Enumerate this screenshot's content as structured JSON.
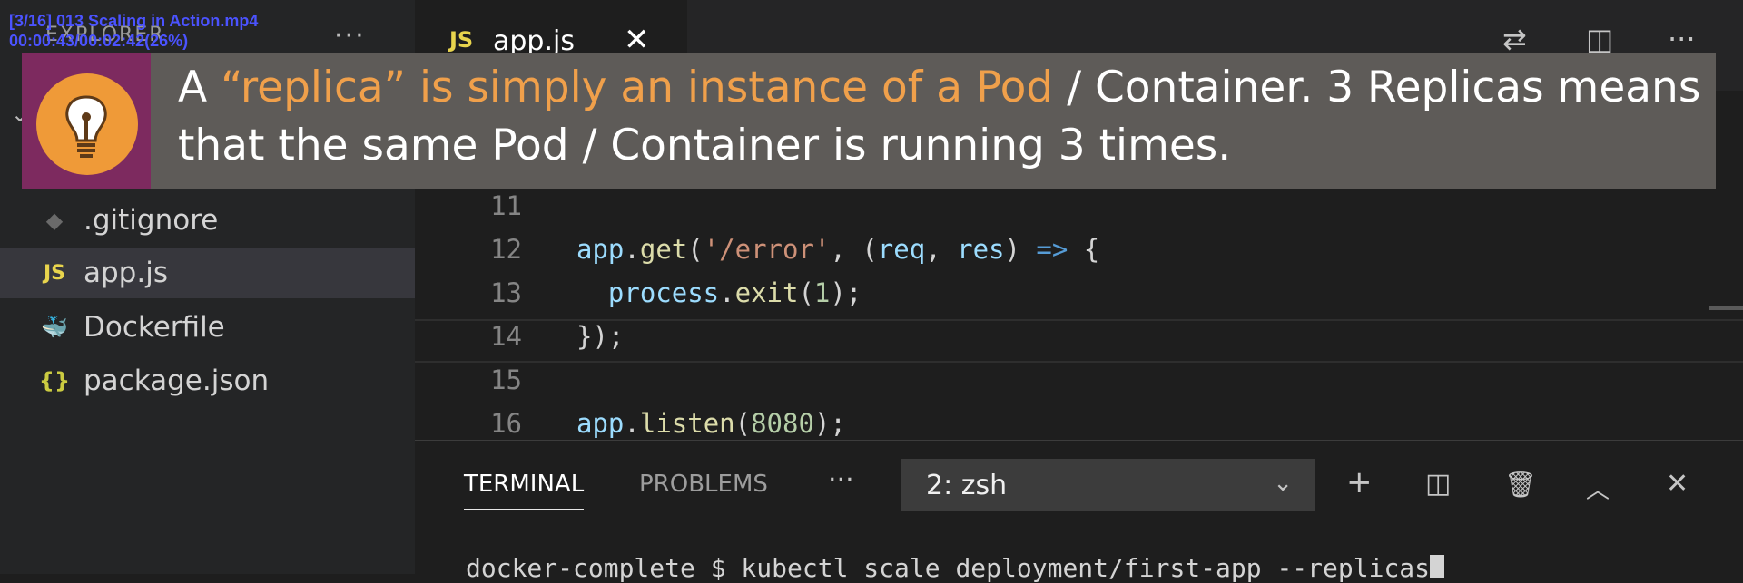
{
  "video": {
    "title": "[3/16] 013 Scaling in Action.mp4",
    "time": "00:00:43/00:02:42(26%)"
  },
  "sidebar": {
    "header": "EXPLORER",
    "more": "···",
    "files": [
      {
        "name": ".gitignore",
        "icon": "git-icon",
        "icon_glyph": "◆"
      },
      {
        "name": "app.js",
        "icon": "js-file-icon",
        "icon_glyph": "JS"
      },
      {
        "name": "Dockerfile",
        "icon": "docker-icon",
        "icon_glyph": "🐳"
      },
      {
        "name": "package.json",
        "icon": "json-file-icon",
        "icon_glyph": "{}"
      }
    ]
  },
  "editor": {
    "tab": {
      "badge": "JS",
      "label": "app.js",
      "close": "✕"
    },
    "toolbar": {
      "compare": "⇄",
      "split": "◫",
      "more": "···"
    },
    "lines": [
      {
        "num": "11",
        "text": ""
      },
      {
        "num": "12",
        "text": "app.get('/error', (req, res) => {"
      },
      {
        "num": "13",
        "text": "  process.exit(1);"
      },
      {
        "num": "14",
        "text": "});"
      },
      {
        "num": "15",
        "text": ""
      },
      {
        "num": "16",
        "text": "app.listen(8080);"
      }
    ]
  },
  "panel": {
    "tabs": [
      "TERMINAL",
      "PROBLEMS"
    ],
    "more": "···",
    "shell": "2: zsh",
    "icons": {
      "add": "+",
      "split": "◫",
      "trash": "🗑",
      "maximize": "︿",
      "close": "✕"
    },
    "terminal_line": "docker-complete $ kubectl scale deployment/first-app --replicas"
  },
  "callout": {
    "prefix": "A ",
    "highlight": "“replica” is simply an instance of a Pod",
    "rest": " / Container. 3 Replicas means that the same Pod / Container is running 3 times.",
    "colors": {
      "highlight": "#f0a04b",
      "icon_bg": "#7d2a5f",
      "bulb": "#ef9a38"
    }
  }
}
